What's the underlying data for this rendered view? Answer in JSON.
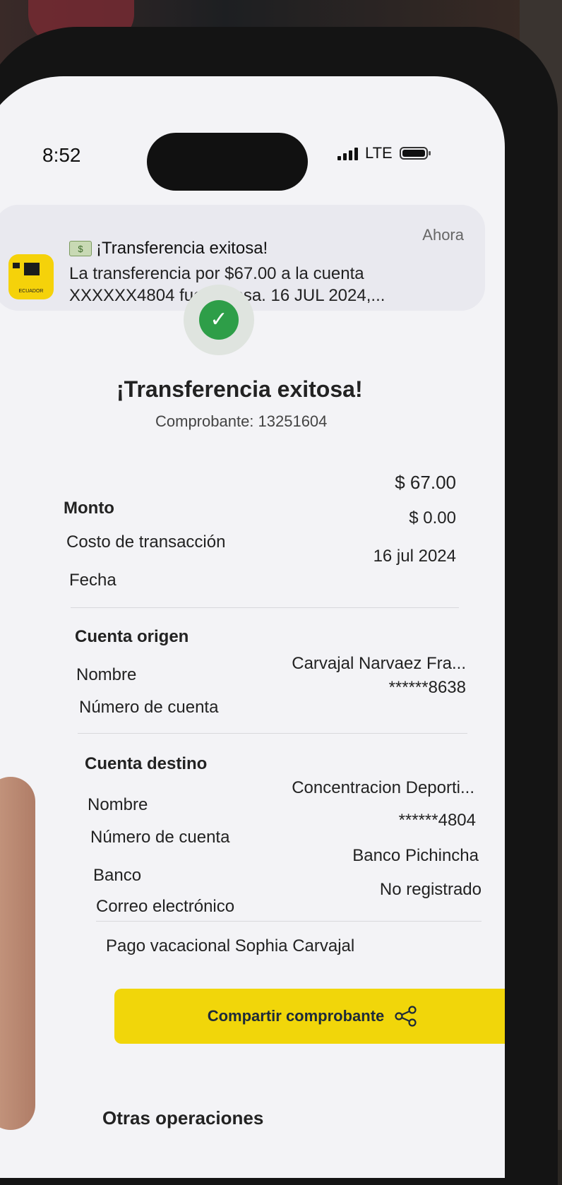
{
  "status_bar": {
    "time": "8:52",
    "network": "LTE"
  },
  "notification": {
    "app_label": "ECUADOR",
    "title": "¡Transferencia exitosa!",
    "body": "La transferencia por $67.00 a la cuenta XXXXXX4804 fue exitosa. 16 JUL 2024,...",
    "time": "Ahora"
  },
  "header": {
    "title": "¡Transferencia exitosa!",
    "receipt": "Comprobante: 13251604"
  },
  "summary": [
    {
      "label": "Monto",
      "value": "$ 67.00"
    },
    {
      "label": "Costo de transacción",
      "value": "$ 0.00"
    },
    {
      "label": "Fecha",
      "value": "16 jul 2024"
    }
  ],
  "origin": {
    "title": "Cuenta origen",
    "rows": [
      {
        "label": "Nombre",
        "value": "Carvajal  Narvaez Fra..."
      },
      {
        "label": "Número de cuenta",
        "value": "******8638"
      }
    ]
  },
  "destination": {
    "title": "Cuenta destino",
    "rows": [
      {
        "label": "Nombre",
        "value": "Concentracion Deporti..."
      },
      {
        "label": "Número de cuenta",
        "value": "******4804"
      },
      {
        "label": "Banco",
        "value": "Banco Pichincha"
      },
      {
        "label": "Correo electrónico",
        "value": "No registrado"
      }
    ]
  },
  "note": "Pago vacacional Sophia Carvajal",
  "share_button": {
    "label": "Compartir comprobante"
  },
  "other_operations": "Otras operaciones",
  "colors": {
    "accent": "#f1d60a",
    "success": "#2e9e48"
  }
}
